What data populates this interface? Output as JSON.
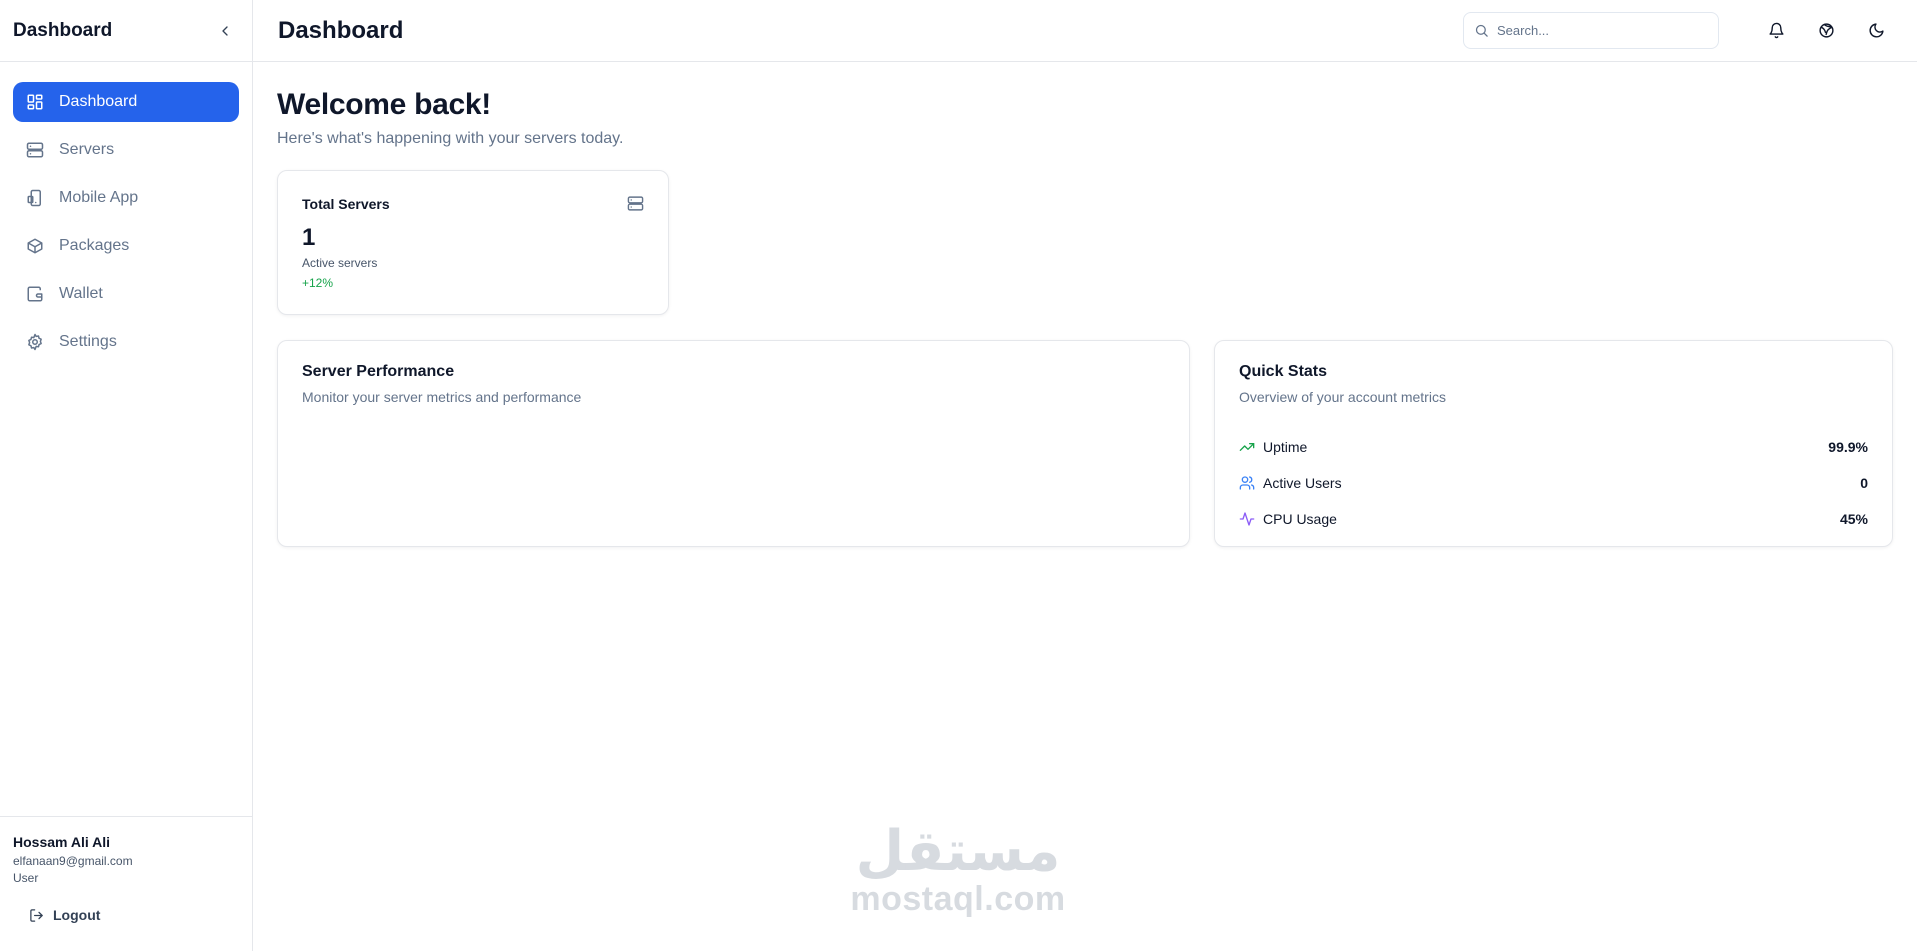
{
  "sidebar": {
    "title": "Dashboard",
    "items": [
      {
        "label": "Dashboard",
        "icon": "dashboard-icon",
        "active": true
      },
      {
        "label": "Servers",
        "icon": "server-icon"
      },
      {
        "label": "Mobile App",
        "icon": "mobile-icon"
      },
      {
        "label": "Packages",
        "icon": "package-icon"
      },
      {
        "label": "Wallet",
        "icon": "wallet-icon"
      },
      {
        "label": "Settings",
        "icon": "gear-icon"
      }
    ],
    "user": {
      "name": "Hossam Ali Ali",
      "email": "elfanaan9@gmail.com",
      "role": "User"
    },
    "logout_label": "Logout"
  },
  "header": {
    "title": "Dashboard",
    "search_placeholder": "Search..."
  },
  "main": {
    "welcome_title": "Welcome back!",
    "welcome_subtitle": "Here's what's happening with your servers today.",
    "total_servers": {
      "label": "Total Servers",
      "value": "1",
      "sub": "Active servers",
      "change": "+12%"
    },
    "performance": {
      "title": "Server Performance",
      "subtitle": "Monitor your server metrics and performance"
    },
    "quick_stats": {
      "title": "Quick Stats",
      "subtitle": "Overview of your account metrics",
      "rows": [
        {
          "label": "Uptime",
          "value": "99.9%",
          "icon": "trending-up-icon",
          "color": "#16a34a"
        },
        {
          "label": "Active Users",
          "value": "0",
          "icon": "users-icon",
          "color": "#3b82f6"
        },
        {
          "label": "CPU Usage",
          "value": "45%",
          "icon": "activity-icon",
          "color": "#8b5cf6"
        }
      ]
    }
  },
  "watermark": {
    "arabic": "مستقل",
    "latin": "mostaql.com"
  },
  "colors": {
    "accent": "#2563eb",
    "positive": "#16a34a"
  }
}
